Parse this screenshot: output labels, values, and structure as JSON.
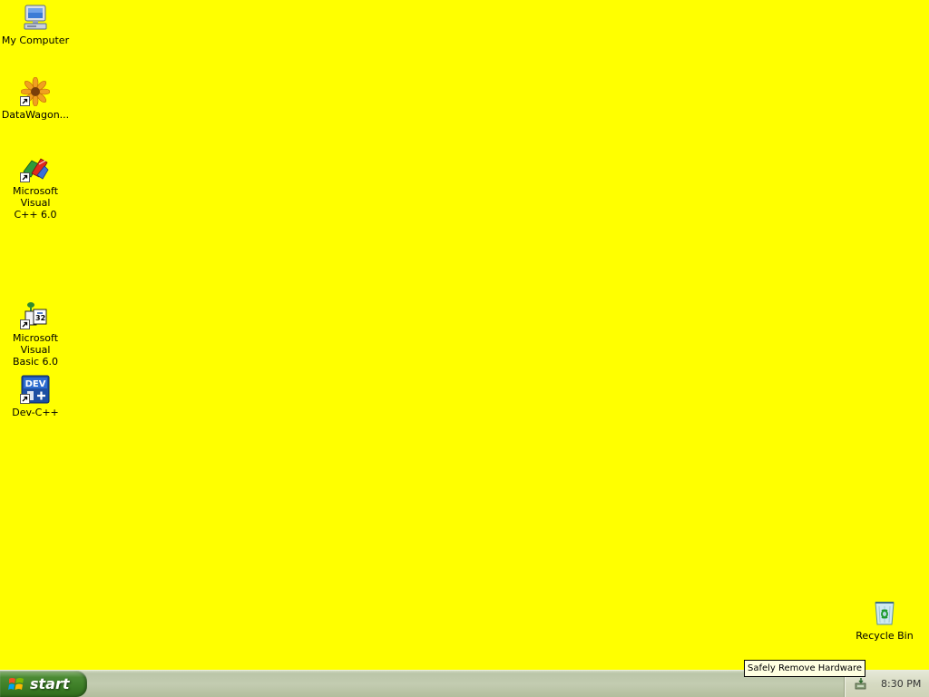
{
  "desktop": {
    "background_color": "#ffff00",
    "icons": [
      {
        "label": "My Computer",
        "icon": "computer-icon"
      },
      {
        "label": "DataWagon...",
        "icon": "sunflower-icon"
      },
      {
        "label": "Microsoft Visual\nC++ 6.0",
        "icon": "visual-cpp-icon"
      },
      {
        "label": "Microsoft Visual\nBasic 6.0",
        "icon": "visual-basic-icon"
      },
      {
        "label": "Dev-C++",
        "icon": "dev-cpp-icon",
        "badge_text": "DEV"
      },
      {
        "label": "Recycle Bin",
        "icon": "recycle-bin-icon"
      }
    ]
  },
  "tooltip": {
    "text": "Safely Remove Hardware"
  },
  "taskbar": {
    "start_label": "start",
    "tray_icon": "safely-remove-hardware-icon",
    "clock": "8:30 PM"
  }
}
